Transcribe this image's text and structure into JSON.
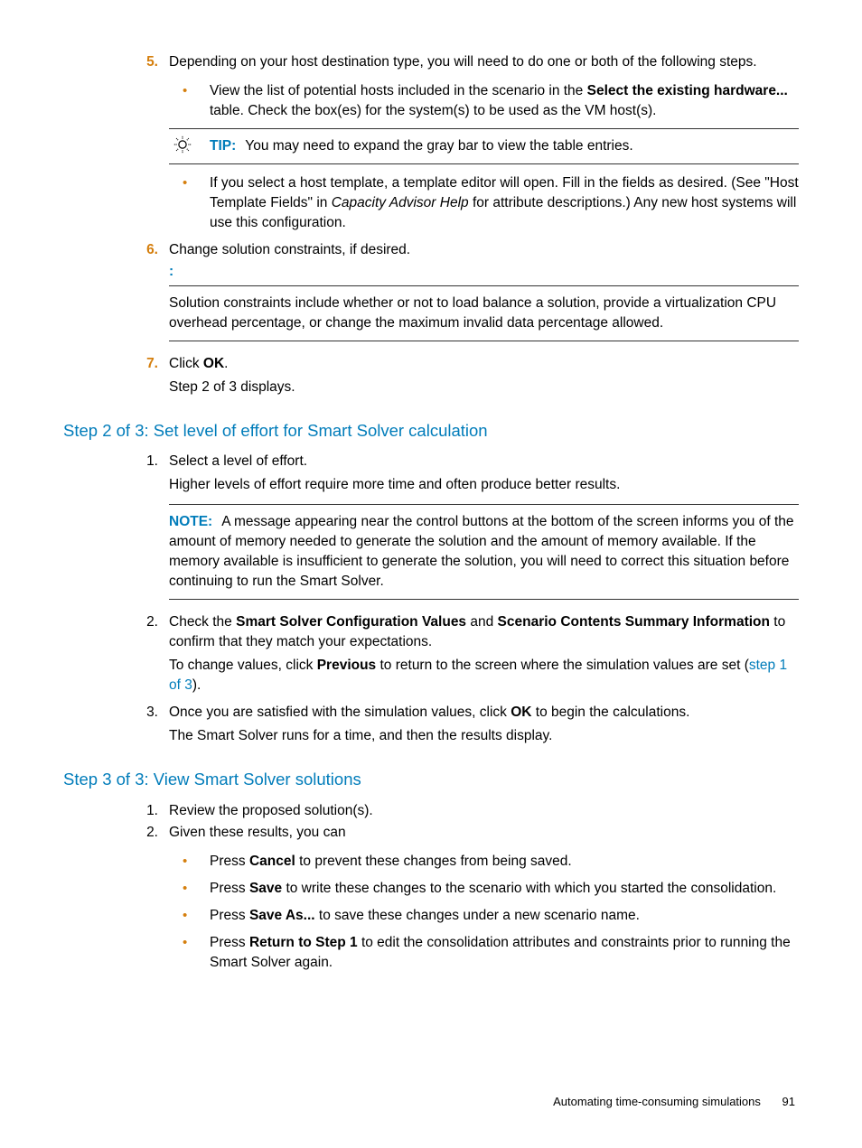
{
  "step5": {
    "num": "5.",
    "text": "Depending on your host destination type, you will need to do one or both of the following steps.",
    "bullet1_a": "View the list of potential hosts included in the scenario in the ",
    "bullet1_b": "Select the existing hardware...",
    "bullet1_c": " table. Check the box(es) for the system(s) to be used as the VM host(s).",
    "tip_label": "TIP:",
    "tip_text": "You may need to expand the gray bar to view the table entries.",
    "bullet2_a": "If you select a host template, a template editor will open. Fill in the fields as desired. (See \"Host Template Fields\" in ",
    "bullet2_b": "Capacity Advisor Help",
    "bullet2_c": " for attribute descriptions.) Any new host systems will use this configuration."
  },
  "step6": {
    "num": "6.",
    "text": "Change solution constraints, if desired.",
    "colon": ":",
    "box_text": "Solution constraints include whether or not to load balance a solution, provide a virtualization CPU overhead percentage, or change the maximum invalid data percentage allowed."
  },
  "step7": {
    "num": "7.",
    "text_a": "Click ",
    "text_b": "OK",
    "text_c": ".",
    "text_d": "Step 2 of 3 displays."
  },
  "h_step2": "Step 2 of 3: Set level of effort for Smart Solver calculation",
  "s2_1": {
    "num": "1.",
    "text": "Select a level of effort.",
    "text2": "Higher levels of effort require more time and often produce better results.",
    "note_label": "NOTE:",
    "note_text": "A message appearing near the control buttons at the bottom of the screen informs you of the amount of memory needed to generate the solution and the amount of memory available. If the memory available is insufficient to generate the solution, you will need to correct this situation before continuing to run the Smart Solver."
  },
  "s2_2": {
    "num": "2.",
    "text_a": "Check the ",
    "text_b": "Smart Solver Configuration Values",
    "text_c": " and ",
    "text_d": "Scenario Contents Summary Information",
    "text_e": " to confirm that they match your expectations.",
    "text2_a": "To change values, click ",
    "text2_b": "Previous",
    "text2_c": " to return to the screen where the simulation values are set (",
    "text2_d": "step 1 of 3",
    "text2_e": ")."
  },
  "s2_3": {
    "num": "3.",
    "text_a": "Once you are satisfied with the simulation values, click ",
    "text_b": "OK",
    "text_c": " to begin the calculations.",
    "text2": "The Smart Solver runs for a time, and then the results display."
  },
  "h_step3": "Step 3 of 3: View Smart Solver solutions",
  "s3_1": {
    "num": "1.",
    "text": "Review the proposed solution(s)."
  },
  "s3_2": {
    "num": "2.",
    "text": "Given these results, you can",
    "b1_a": "Press ",
    "b1_b": "Cancel",
    "b1_c": " to prevent these changes from being saved.",
    "b2_a": "Press ",
    "b2_b": "Save",
    "b2_c": " to write these changes to the scenario with which you started the consolidation.",
    "b3_a": "Press ",
    "b3_b": "Save As...",
    "b3_c": " to save these changes under a new scenario name.",
    "b4_a": "Press ",
    "b4_b": "Return to Step 1",
    "b4_c": " to edit the consolidation attributes and constraints prior to running the Smart Solver again."
  },
  "footer": {
    "text": "Automating time-consuming simulations",
    "page": "91"
  }
}
